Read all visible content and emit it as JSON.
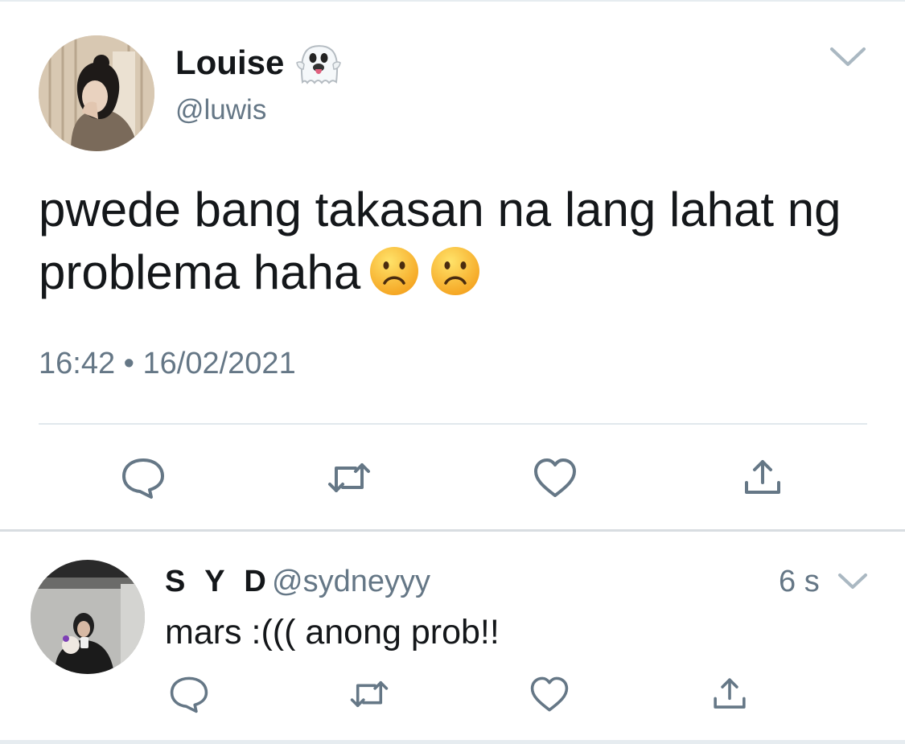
{
  "main_tweet": {
    "display_name": "Louise",
    "name_emoji": "ghost-emoji",
    "handle": "@luwis",
    "text": "pwede bang takasan na lang lahat ng problema haha",
    "text_emojis": [
      "frowning-face-emoji",
      "frowning-face-emoji"
    ],
    "timestamp": "16:42 • 16/02/2021",
    "actions": [
      "reply-icon",
      "retweet-icon",
      "like-icon",
      "share-icon"
    ]
  },
  "reply": {
    "display_name": "S Y D",
    "handle": "@sydneyyy",
    "time": "6 s",
    "text": "mars :((( anong prob!!",
    "actions": [
      "reply-icon",
      "retweet-icon",
      "like-icon",
      "share-icon"
    ]
  },
  "colors": {
    "text": "#14171a",
    "secondary": "#657786",
    "icon": "#657786",
    "divider": "#e1e8ed",
    "background": "#ffffff"
  }
}
